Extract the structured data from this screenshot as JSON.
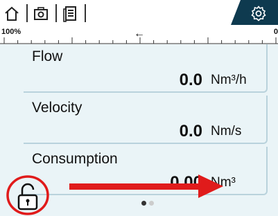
{
  "toolbar": {
    "home_icon": "home-icon",
    "camera_icon": "camera-icon",
    "report_icon": "report-icon",
    "settings_icon": "gear-icon"
  },
  "scale": {
    "left_label": "100%",
    "right_label": "0",
    "direction_arrow": "←"
  },
  "cards": [
    {
      "label": "Flow",
      "value": "0.0",
      "unit": "Nm³/h"
    },
    {
      "label": "Velocity",
      "value": "0.0",
      "unit": "Nm/s"
    },
    {
      "label": "Consumption",
      "value": "0.00",
      "unit": "Nm³"
    }
  ],
  "pager": {
    "pages": 2,
    "active": 1
  },
  "colors": {
    "accent": "#0e3a4f",
    "card_bg": "#eaf4f7",
    "card_border": "#b9d2dc",
    "annotation_red": "#e01b1b"
  }
}
